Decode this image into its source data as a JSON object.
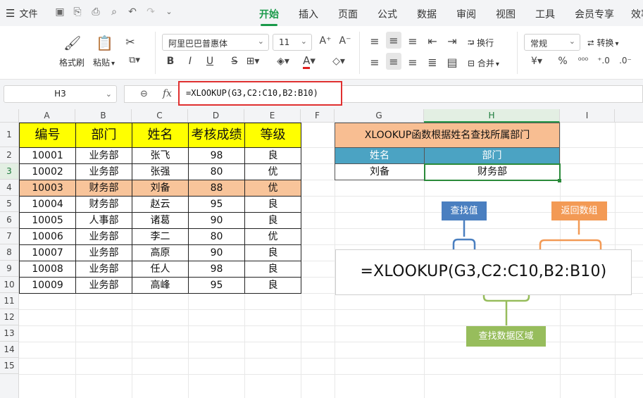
{
  "menu": {
    "file_label": "文件",
    "tabs": [
      "开始",
      "插入",
      "页面",
      "公式",
      "数据",
      "审阅",
      "视图",
      "工具",
      "会员专享",
      "效率"
    ],
    "active_tab": "开始"
  },
  "ribbon": {
    "format_painter": "格式刷",
    "paste": "粘贴",
    "font_name": "阿里巴巴普惠体",
    "font_size": "11",
    "wrap_text": "换行",
    "number_format": "常规",
    "convert": "转换",
    "merge": "合并",
    "bold": "B",
    "italic": "I",
    "underline": "U",
    "currency": "¥",
    "percent": "%"
  },
  "formula_bar": {
    "name_box": "H3",
    "fx": "fx",
    "formula": "=XLOOKUP(G3,C2:C10,B2:B10)"
  },
  "columns": [
    "A",
    "B",
    "C",
    "D",
    "E",
    "F",
    "G",
    "H",
    "I"
  ],
  "rows": [
    "1",
    "2",
    "3",
    "4",
    "5",
    "6",
    "7",
    "8",
    "9",
    "10",
    "11",
    "12",
    "13",
    "14",
    "15"
  ],
  "table": {
    "headers": [
      "编号",
      "部门",
      "姓名",
      "考核成绩",
      "等级"
    ],
    "rows": [
      [
        "10001",
        "业务部",
        "张飞",
        "98",
        "良"
      ],
      [
        "10002",
        "业务部",
        "张强",
        "80",
        "优"
      ],
      [
        "10003",
        "财务部",
        "刘备",
        "88",
        "优"
      ],
      [
        "10004",
        "财务部",
        "赵云",
        "95",
        "良"
      ],
      [
        "10005",
        "人事部",
        "诸葛",
        "90",
        "良"
      ],
      [
        "10006",
        "业务部",
        "李二",
        "80",
        "优"
      ],
      [
        "10007",
        "业务部",
        "高原",
        "90",
        "良"
      ],
      [
        "10008",
        "业务部",
        "任人",
        "98",
        "良"
      ],
      [
        "10009",
        "业务部",
        "高峰",
        "95",
        "良"
      ]
    ],
    "highlight_row_index": 2
  },
  "lookup": {
    "title": "XLOOKUP函数根据姓名查找所属部门",
    "name_header": "姓名",
    "dept_header": "部门",
    "name_value": "刘备",
    "dept_value": "财务部"
  },
  "annotation": {
    "formula": "=XLOOKUP(G3,C2:C10,B2:B10)",
    "lookup_value_label": "查找值",
    "return_array_label": "返回数组",
    "lookup_array_label": "查找数据区域"
  },
  "colors": {
    "accent": "#1a9a4a",
    "header_yellow": "#ffff00",
    "highlight_orange": "#f8c49a",
    "lookup_blue": "#4ba3c3",
    "tag_blue": "#4a7fc0",
    "tag_orange": "#f39a55",
    "tag_green": "#97bd5c",
    "formula_border": "#e03030"
  }
}
